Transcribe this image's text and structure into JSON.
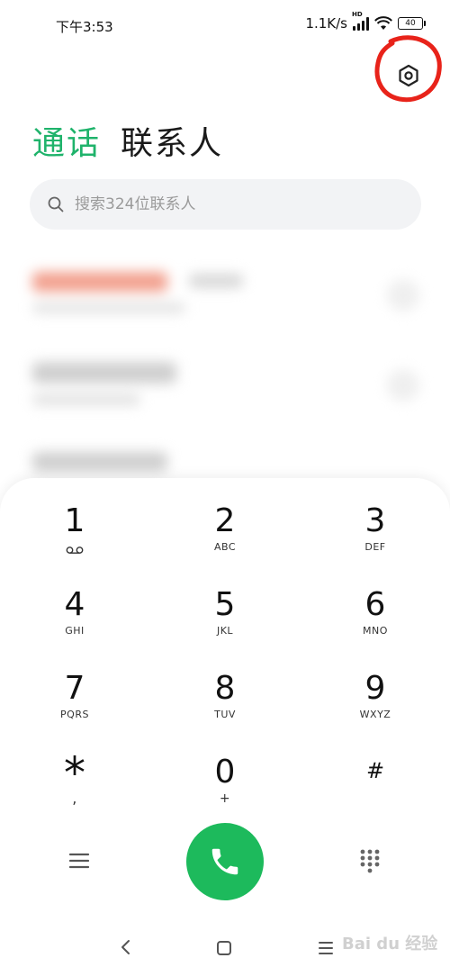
{
  "status_bar": {
    "time": "下午3:53",
    "speed": "1.1K/s",
    "hd": "HD",
    "battery": "40"
  },
  "icons": {
    "settings": "gear-icon",
    "search": "search-icon",
    "menu": "menu-icon",
    "call": "phone-icon",
    "keypad": "dialpad-icon"
  },
  "tabs": [
    {
      "label": "通话",
      "active": true
    },
    {
      "label": "联系人",
      "active": false
    }
  ],
  "search": {
    "placeholder": "搜索324位联系人"
  },
  "dialpad": {
    "keys": [
      {
        "num": "1",
        "sub": ""
      },
      {
        "num": "2",
        "sub": "ABC"
      },
      {
        "num": "3",
        "sub": "DEF"
      },
      {
        "num": "4",
        "sub": "GHI"
      },
      {
        "num": "5",
        "sub": "JKL"
      },
      {
        "num": "6",
        "sub": "MNO"
      },
      {
        "num": "7",
        "sub": "PQRS"
      },
      {
        "num": "8",
        "sub": "TUV"
      },
      {
        "num": "9",
        "sub": "WXYZ"
      },
      {
        "num": "*",
        "sub": ","
      },
      {
        "num": "0",
        "sub": "+"
      },
      {
        "num": "#",
        "sub": ""
      }
    ]
  },
  "watermark": "Bai du 经验",
  "colors": {
    "accent": "#1fb36b",
    "call_button": "#1dba5c",
    "annotation": "#e8231a"
  }
}
